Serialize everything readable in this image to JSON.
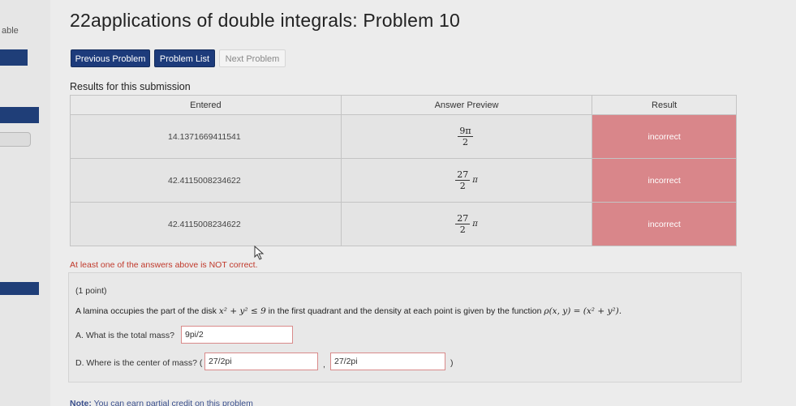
{
  "sidebar": {
    "text": "able"
  },
  "title": "22applications of double integrals: Problem 10",
  "nav": {
    "previous_label": "Previous Problem",
    "list_label": "Problem List",
    "next_label": "Next Problem"
  },
  "results": {
    "title": "Results for this submission",
    "headers": {
      "entered": "Entered",
      "preview": "Answer Preview",
      "result": "Result"
    },
    "rows": [
      {
        "entered": "14.1371669411541",
        "preview_num": "9π",
        "preview_den": "2",
        "preview_suffix": "",
        "result": "incorrect"
      },
      {
        "entered": "42.4115008234622",
        "preview_num": "27",
        "preview_den": "2",
        "preview_suffix": "π",
        "result": "incorrect"
      },
      {
        "entered": "42.4115008234622",
        "preview_num": "27",
        "preview_den": "2",
        "preview_suffix": "π",
        "result": "incorrect"
      }
    ],
    "warning": "At least one of the answers above is NOT correct."
  },
  "problem": {
    "points": "(1 point)",
    "statement_a": "A lamina occupies the part of the disk ",
    "disk_math": "x² + y² ≤ 9",
    "statement_b": " in the first quadrant and the density at each point is given by the function ",
    "density_math": "ρ(x, y) = (x² + y²).",
    "question_a": "A. What is the total mass?",
    "answer_a": "9pi/2",
    "question_d": "D. Where is the center of mass? (",
    "answer_d1": "27/2pi",
    "comma": ",",
    "answer_d2": "27/2pi",
    "close_paren": ")"
  },
  "note": {
    "label": "Note:",
    "text": " You can earn partial credit on this problem"
  },
  "colors": {
    "primary": "#1d3b7b",
    "incorrect_bg": "#d9868a",
    "warning": "#c0392b"
  }
}
